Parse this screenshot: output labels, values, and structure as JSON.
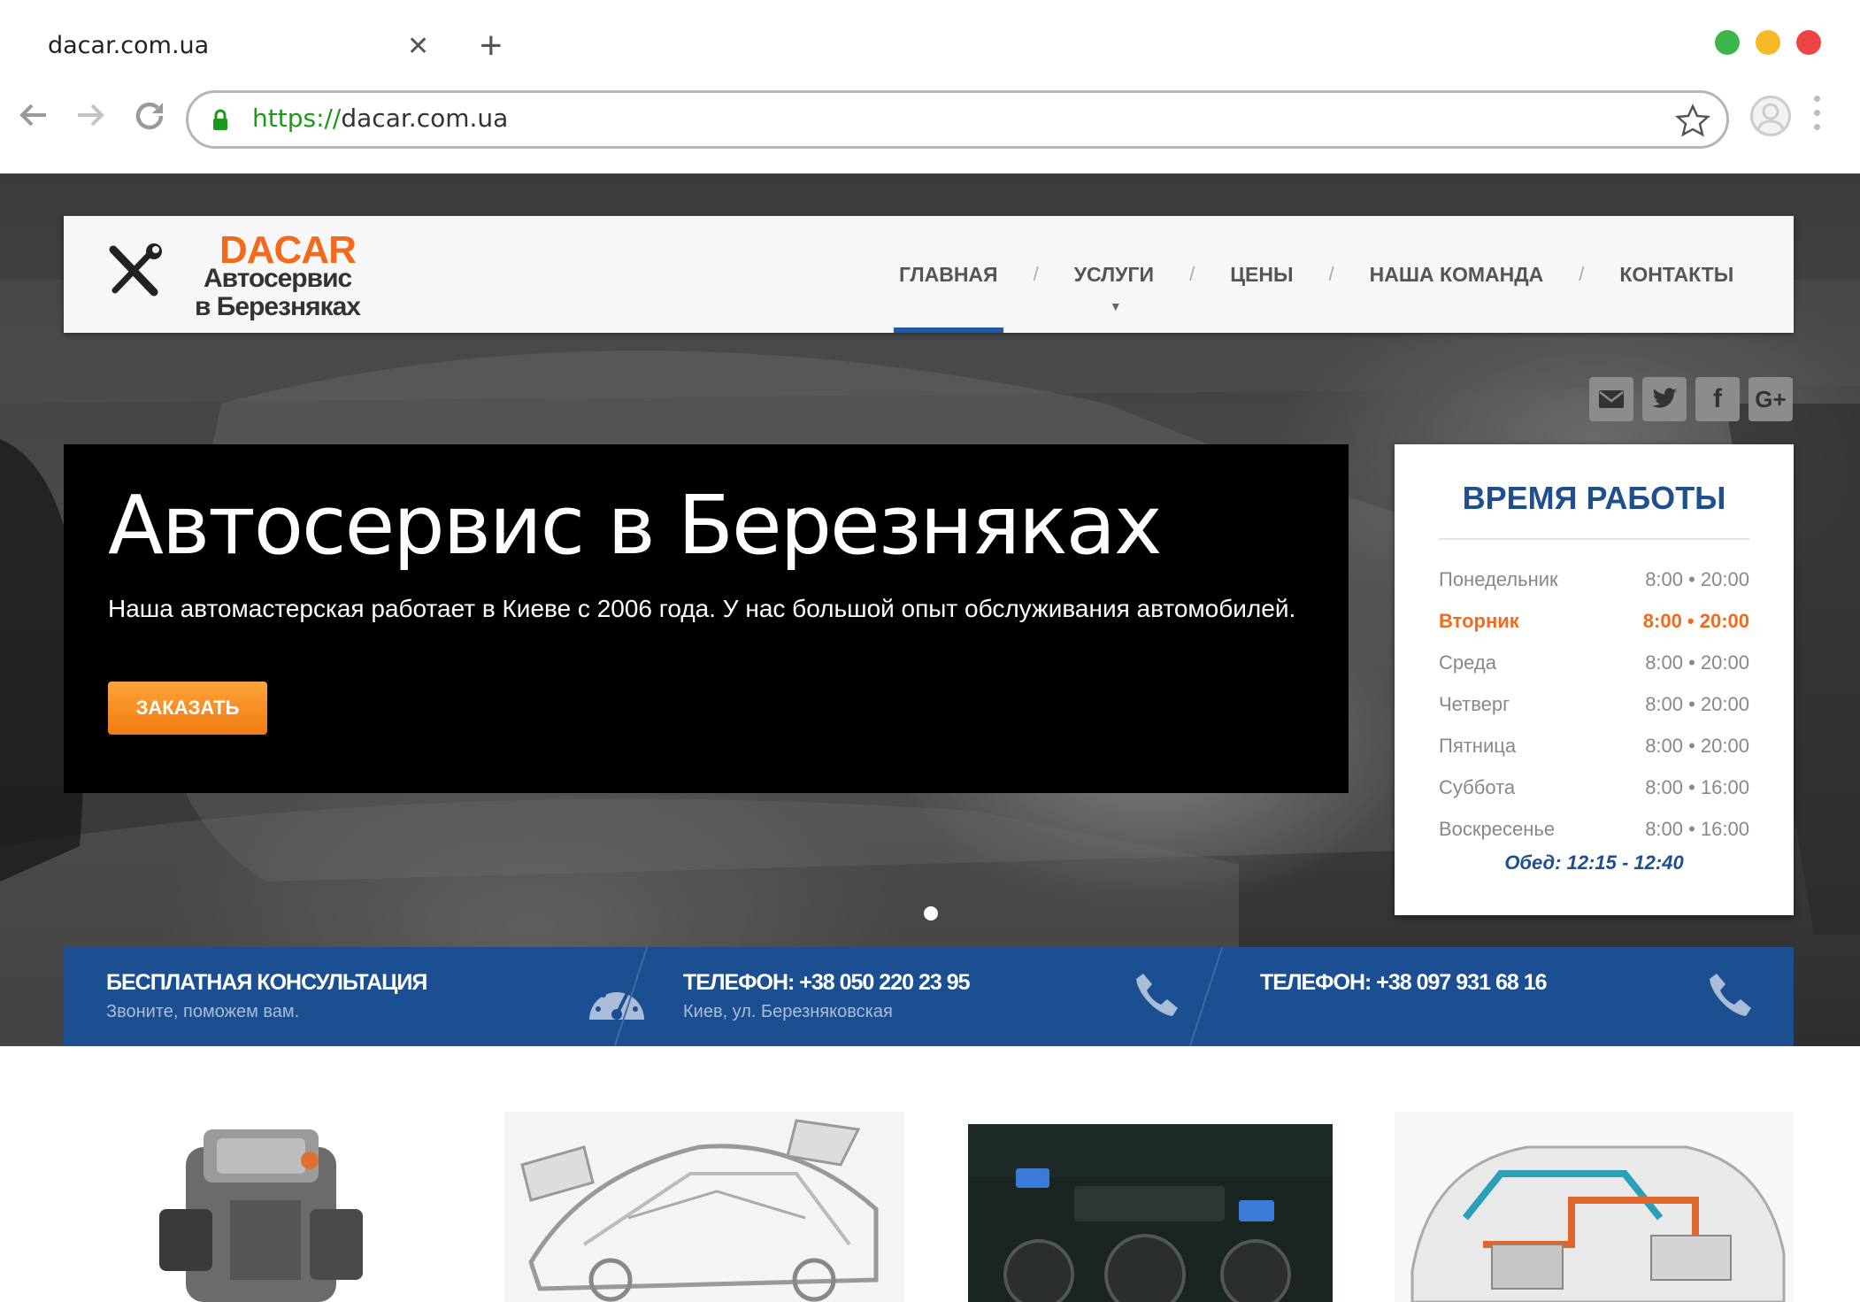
{
  "browser": {
    "tab_title": "dacar.com.ua",
    "url_scheme": "https://",
    "url_host": "dacar.com.ua",
    "window_colors": {
      "green": "#3cb64a",
      "yellow": "#f7b928",
      "red": "#ef4444"
    }
  },
  "site": {
    "logo": {
      "brand": "DACAR",
      "line1": "Автосервис",
      "line2": "в Березняках"
    },
    "nav": [
      {
        "label": "ГЛАВНАЯ",
        "active": true
      },
      {
        "label": "УСЛУГИ",
        "has_dropdown": true
      },
      {
        "label": "ЦЕНЫ"
      },
      {
        "label": "НАША КОМАНДА"
      },
      {
        "label": "КОНТАКТЫ"
      }
    ],
    "nav_separator": "/",
    "social": [
      {
        "icon": "mail-icon"
      },
      {
        "icon": "twitter-icon"
      },
      {
        "icon": "facebook-icon",
        "glyph": "f"
      },
      {
        "icon": "google-plus-icon",
        "glyph": "G+"
      }
    ],
    "hero": {
      "title": "Автосервис в Березняках",
      "subtitle": "Наша автомастерская работает в Киеве с 2006 года. У нас большой опыт обслуживания автомобилей.",
      "order_button": "ЗАКАЗАТЬ"
    },
    "hours": {
      "title": "ВРЕМЯ РАБОТЫ",
      "rows": [
        {
          "day": "Понедельник",
          "time": "8:00 • 20:00"
        },
        {
          "day": "Вторник",
          "time": "8:00 • 20:00",
          "today": true
        },
        {
          "day": "Среда",
          "time": "8:00 • 20:00"
        },
        {
          "day": "Четверг",
          "time": "8:00 • 20:00"
        },
        {
          "day": "Пятница",
          "time": "8:00 • 20:00"
        },
        {
          "day": "Суббота",
          "time": "8:00 • 16:00"
        },
        {
          "day": "Воскресенье",
          "time": "8:00 • 16:00"
        }
      ],
      "lunch": "Обед: 12:15 - 12:40"
    },
    "infobar": [
      {
        "title": "БЕСПЛАТНАЯ КОНСУЛЬТАЦИЯ",
        "subtitle": "Звоните, поможем вам.",
        "icon": "speedometer-icon"
      },
      {
        "title": "ТЕЛЕФОН: +38 050 220 23 95",
        "subtitle": "Киев, ул. Березняковская",
        "icon": "phone-icon"
      },
      {
        "title": "ТЕЛЕФОН: +38 097 931 68 16",
        "subtitle": "",
        "icon": "phone-icon"
      }
    ],
    "services_thumbnails": [
      "engine-image",
      "car-body-image",
      "climate-control-image",
      "fuel-system-image"
    ],
    "colors": {
      "brand_orange": "#f26a1b",
      "brand_blue": "#1c4f92",
      "active_nav": "#1e5aa8"
    }
  }
}
